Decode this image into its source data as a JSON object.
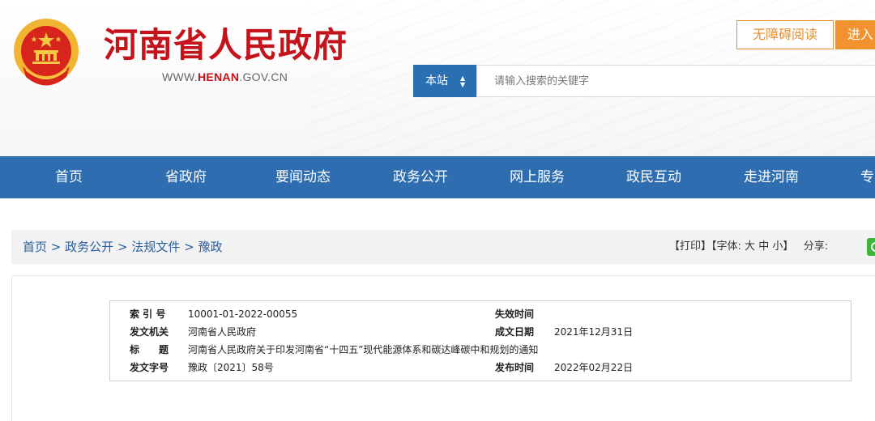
{
  "site": {
    "name": "河南省人民政府",
    "url_prefix": "WWW.",
    "url_brand": "HENAN",
    "url_suffix": ".GOV.CN",
    "accessibility_label": "无障碍阅读",
    "enter_label": "进入"
  },
  "search": {
    "scope_label": "本站",
    "placeholder": "请输入搜索的关键字"
  },
  "nav": {
    "items": [
      "首页",
      "省政府",
      "要闻动态",
      "政务公开",
      "网上服务",
      "政民互动",
      "走进河南",
      "专"
    ]
  },
  "breadcrumb": {
    "items": [
      "首页",
      "政务公开",
      "法规文件",
      "豫政"
    ],
    "separator": ">"
  },
  "tools": {
    "print": "【打印】",
    "font_prefix": "【字体:",
    "font_large": "大",
    "font_medium": "中",
    "font_small": "小",
    "font_suffix": "】",
    "share": "分享:"
  },
  "meta": {
    "index_label": "索 引 号",
    "index_value": "10001-01-2022-00055",
    "expiry_label": "失效时间",
    "expiry_value": "",
    "issuer_label": "发文机关",
    "issuer_value": "河南省人民政府",
    "created_label": "成文日期",
    "created_value": "2021年12月31日",
    "title_label_1": "标",
    "title_label_2": "题",
    "title_value": "河南省人民政府关于印发河南省“十四五”现代能源体系和碳达峰碳中和规划的通知",
    "doc_no_label": "发文字号",
    "doc_no_value": "豫政〔2021〕58号",
    "published_label": "发布时间",
    "published_value": "2022年02月22日"
  },
  "colors": {
    "brand_red": "#c4131b",
    "nav_blue": "#2e6db0",
    "accent_orange": "#f0922e",
    "link_blue": "#2a5f9e"
  }
}
